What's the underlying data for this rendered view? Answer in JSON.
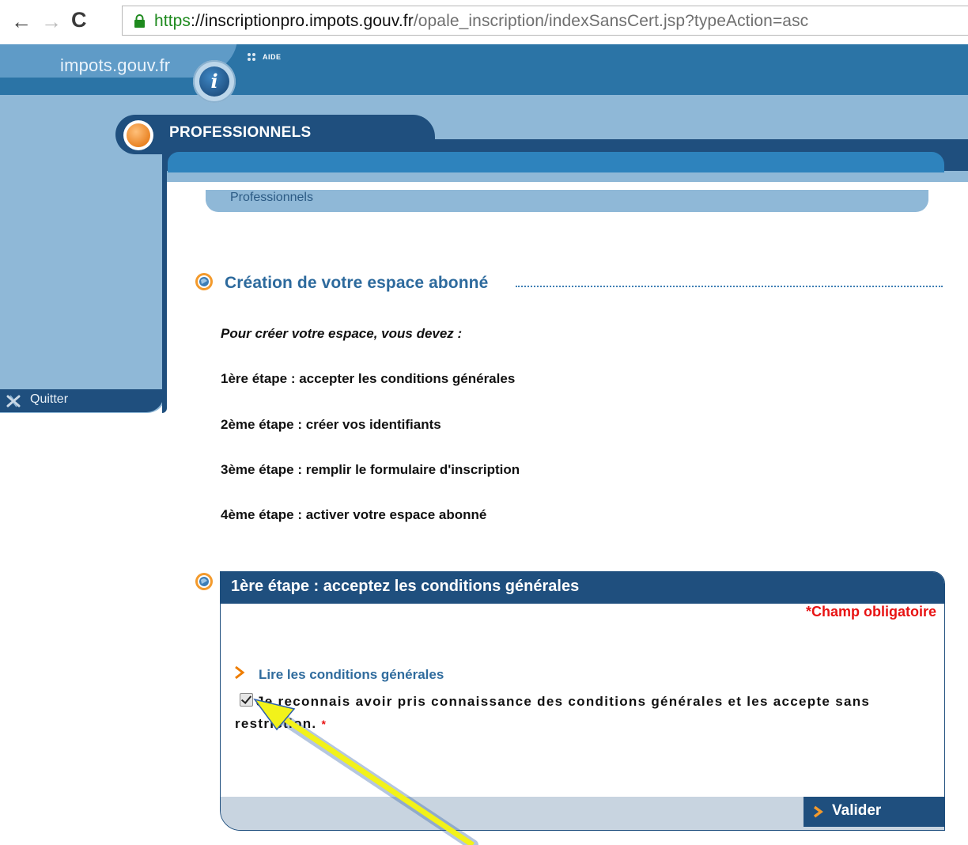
{
  "browser": {
    "back_glyph": "←",
    "forward_glyph": "→",
    "reload_glyph": "C",
    "url_scheme": "https",
    "url_separator": "://",
    "url_host": "inscriptionpro.impots.gouv.fr",
    "url_path": "/opale_inscription/indexSansCert.jsp?typeAction=asc"
  },
  "header": {
    "logo_text": "impots.gouv.fr",
    "logo_glyph": "i",
    "help_label": "AIDE",
    "section_tab": "PROFESSIONNELS"
  },
  "sidebar": {
    "quit_label": "Quitter"
  },
  "breadcrumb": {
    "label": "Professionnels"
  },
  "main": {
    "title": "Création de votre espace abonné",
    "intro": "Pour créer votre espace, vous devez :",
    "steps": [
      "1ère étape : accepter les conditions générales",
      "2ème étape : créer vos identifiants",
      "3ème étape : remplir le formulaire d'inscription",
      "4ème étape : activer votre espace abonné"
    ]
  },
  "step_panel": {
    "title": "1ère étape : acceptez les conditions générales",
    "required_note": "*Champ obligatoire",
    "conditions_link": "Lire les conditions générales",
    "accept_text": "Je reconnais avoir pris connaissance des conditions générales et les accepte sans restriction.",
    "accept_checked": true,
    "required_star": "*",
    "submit_label": "Valider"
  },
  "colors": {
    "navy": "#1f4f7e",
    "blue": "#2b74a6",
    "light_blue": "#8fb8d7",
    "link_blue": "#2f6b9d",
    "required_red": "#e81313",
    "annotation_yellow": "#f2f21a"
  },
  "icons": {
    "lock": "lock-icon",
    "quit": "quit-icon",
    "section": "section-bullet-icon",
    "chevron": "chevron-right-icon"
  }
}
